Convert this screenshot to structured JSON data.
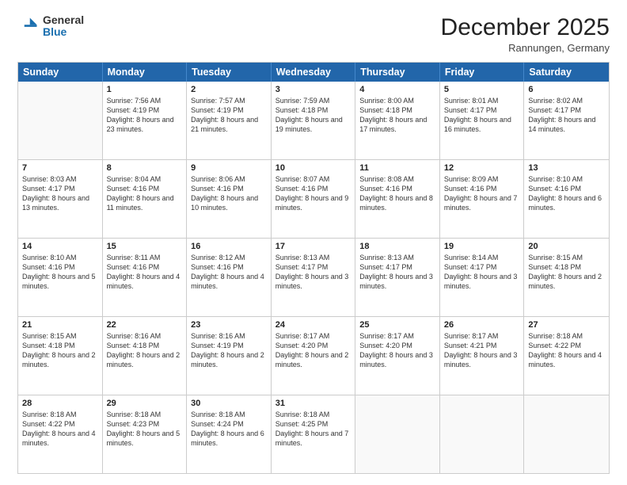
{
  "logo": {
    "general": "General",
    "blue": "Blue"
  },
  "header": {
    "month": "December 2025",
    "location": "Rannungen, Germany"
  },
  "days": [
    "Sunday",
    "Monday",
    "Tuesday",
    "Wednesday",
    "Thursday",
    "Friday",
    "Saturday"
  ],
  "weeks": [
    [
      {
        "day": "",
        "empty": true
      },
      {
        "day": "1",
        "sunrise": "Sunrise: 7:56 AM",
        "sunset": "Sunset: 4:19 PM",
        "daylight": "Daylight: 8 hours and 23 minutes."
      },
      {
        "day": "2",
        "sunrise": "Sunrise: 7:57 AM",
        "sunset": "Sunset: 4:19 PM",
        "daylight": "Daylight: 8 hours and 21 minutes."
      },
      {
        "day": "3",
        "sunrise": "Sunrise: 7:59 AM",
        "sunset": "Sunset: 4:18 PM",
        "daylight": "Daylight: 8 hours and 19 minutes."
      },
      {
        "day": "4",
        "sunrise": "Sunrise: 8:00 AM",
        "sunset": "Sunset: 4:18 PM",
        "daylight": "Daylight: 8 hours and 17 minutes."
      },
      {
        "day": "5",
        "sunrise": "Sunrise: 8:01 AM",
        "sunset": "Sunset: 4:17 PM",
        "daylight": "Daylight: 8 hours and 16 minutes."
      },
      {
        "day": "6",
        "sunrise": "Sunrise: 8:02 AM",
        "sunset": "Sunset: 4:17 PM",
        "daylight": "Daylight: 8 hours and 14 minutes."
      }
    ],
    [
      {
        "day": "7",
        "sunrise": "Sunrise: 8:03 AM",
        "sunset": "Sunset: 4:17 PM",
        "daylight": "Daylight: 8 hours and 13 minutes."
      },
      {
        "day": "8",
        "sunrise": "Sunrise: 8:04 AM",
        "sunset": "Sunset: 4:16 PM",
        "daylight": "Daylight: 8 hours and 11 minutes."
      },
      {
        "day": "9",
        "sunrise": "Sunrise: 8:06 AM",
        "sunset": "Sunset: 4:16 PM",
        "daylight": "Daylight: 8 hours and 10 minutes."
      },
      {
        "day": "10",
        "sunrise": "Sunrise: 8:07 AM",
        "sunset": "Sunset: 4:16 PM",
        "daylight": "Daylight: 8 hours and 9 minutes."
      },
      {
        "day": "11",
        "sunrise": "Sunrise: 8:08 AM",
        "sunset": "Sunset: 4:16 PM",
        "daylight": "Daylight: 8 hours and 8 minutes."
      },
      {
        "day": "12",
        "sunrise": "Sunrise: 8:09 AM",
        "sunset": "Sunset: 4:16 PM",
        "daylight": "Daylight: 8 hours and 7 minutes."
      },
      {
        "day": "13",
        "sunrise": "Sunrise: 8:10 AM",
        "sunset": "Sunset: 4:16 PM",
        "daylight": "Daylight: 8 hours and 6 minutes."
      }
    ],
    [
      {
        "day": "14",
        "sunrise": "Sunrise: 8:10 AM",
        "sunset": "Sunset: 4:16 PM",
        "daylight": "Daylight: 8 hours and 5 minutes."
      },
      {
        "day": "15",
        "sunrise": "Sunrise: 8:11 AM",
        "sunset": "Sunset: 4:16 PM",
        "daylight": "Daylight: 8 hours and 4 minutes."
      },
      {
        "day": "16",
        "sunrise": "Sunrise: 8:12 AM",
        "sunset": "Sunset: 4:16 PM",
        "daylight": "Daylight: 8 hours and 4 minutes."
      },
      {
        "day": "17",
        "sunrise": "Sunrise: 8:13 AM",
        "sunset": "Sunset: 4:17 PM",
        "daylight": "Daylight: 8 hours and 3 minutes."
      },
      {
        "day": "18",
        "sunrise": "Sunrise: 8:13 AM",
        "sunset": "Sunset: 4:17 PM",
        "daylight": "Daylight: 8 hours and 3 minutes."
      },
      {
        "day": "19",
        "sunrise": "Sunrise: 8:14 AM",
        "sunset": "Sunset: 4:17 PM",
        "daylight": "Daylight: 8 hours and 3 minutes."
      },
      {
        "day": "20",
        "sunrise": "Sunrise: 8:15 AM",
        "sunset": "Sunset: 4:18 PM",
        "daylight": "Daylight: 8 hours and 2 minutes."
      }
    ],
    [
      {
        "day": "21",
        "sunrise": "Sunrise: 8:15 AM",
        "sunset": "Sunset: 4:18 PM",
        "daylight": "Daylight: 8 hours and 2 minutes."
      },
      {
        "day": "22",
        "sunrise": "Sunrise: 8:16 AM",
        "sunset": "Sunset: 4:18 PM",
        "daylight": "Daylight: 8 hours and 2 minutes."
      },
      {
        "day": "23",
        "sunrise": "Sunrise: 8:16 AM",
        "sunset": "Sunset: 4:19 PM",
        "daylight": "Daylight: 8 hours and 2 minutes."
      },
      {
        "day": "24",
        "sunrise": "Sunrise: 8:17 AM",
        "sunset": "Sunset: 4:20 PM",
        "daylight": "Daylight: 8 hours and 2 minutes."
      },
      {
        "day": "25",
        "sunrise": "Sunrise: 8:17 AM",
        "sunset": "Sunset: 4:20 PM",
        "daylight": "Daylight: 8 hours and 3 minutes."
      },
      {
        "day": "26",
        "sunrise": "Sunrise: 8:17 AM",
        "sunset": "Sunset: 4:21 PM",
        "daylight": "Daylight: 8 hours and 3 minutes."
      },
      {
        "day": "27",
        "sunrise": "Sunrise: 8:18 AM",
        "sunset": "Sunset: 4:22 PM",
        "daylight": "Daylight: 8 hours and 4 minutes."
      }
    ],
    [
      {
        "day": "28",
        "sunrise": "Sunrise: 8:18 AM",
        "sunset": "Sunset: 4:22 PM",
        "daylight": "Daylight: 8 hours and 4 minutes."
      },
      {
        "day": "29",
        "sunrise": "Sunrise: 8:18 AM",
        "sunset": "Sunset: 4:23 PM",
        "daylight": "Daylight: 8 hours and 5 minutes."
      },
      {
        "day": "30",
        "sunrise": "Sunrise: 8:18 AM",
        "sunset": "Sunset: 4:24 PM",
        "daylight": "Daylight: 8 hours and 6 minutes."
      },
      {
        "day": "31",
        "sunrise": "Sunrise: 8:18 AM",
        "sunset": "Sunset: 4:25 PM",
        "daylight": "Daylight: 8 hours and 7 minutes."
      },
      {
        "day": "",
        "empty": true
      },
      {
        "day": "",
        "empty": true
      },
      {
        "day": "",
        "empty": true
      }
    ]
  ]
}
